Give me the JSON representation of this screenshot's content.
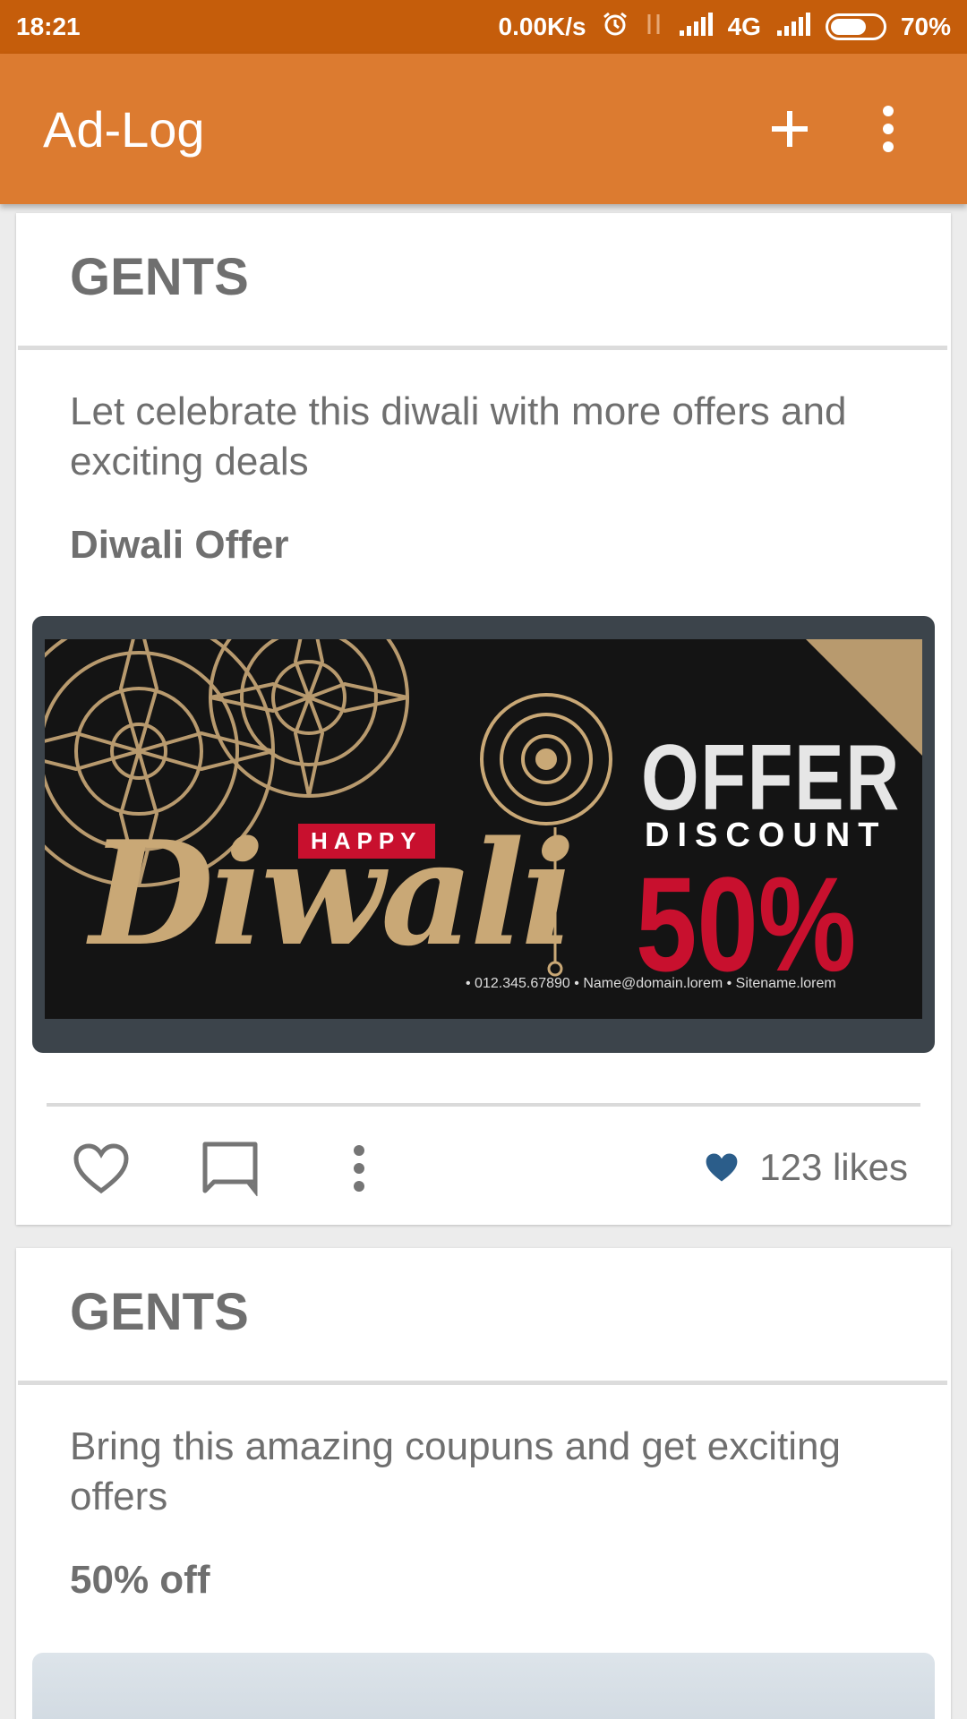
{
  "status_bar": {
    "time": "18:21",
    "net_speed": "0.00K/s",
    "network_type": "4G",
    "battery": "70%",
    "battery_level": 0.7
  },
  "app_bar": {
    "title": "Ad-Log",
    "add_icon": "plus-icon",
    "menu_icon": "overflow-menu-icon"
  },
  "posts": [
    {
      "category": "GENTS",
      "description": "Let celebrate this diwali with more offers and exciting deals",
      "offer_title": "Diwali Offer",
      "banner": {
        "happy": "HAPPY",
        "script": "Diwali",
        "offer": "OFFER",
        "discount": "DISCOUNT",
        "percent": "50%",
        "contact": "• 012.345.67890  • Name@domain.lorem  • Sitename.lorem"
      },
      "likes": "123 likes"
    },
    {
      "category": "GENTS",
      "description": "Bring this amazing coupuns and get exciting offers",
      "offer_title": "50% off"
    }
  ],
  "colors": {
    "status_bar": "#c55d0b",
    "app_bar": "#dc7b30",
    "heart_filled": "#2b5d8a",
    "discount_red": "#c8102e",
    "gold": "#c9a876"
  }
}
